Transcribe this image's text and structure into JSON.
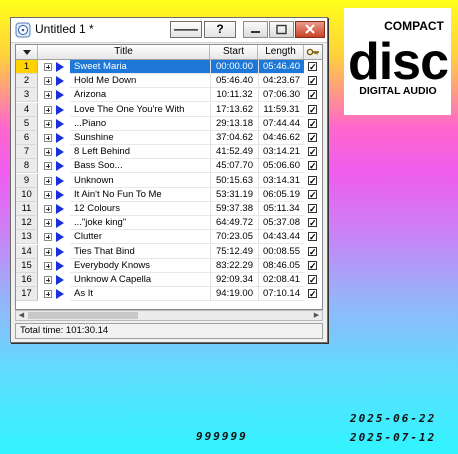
{
  "window": {
    "title": "Untitled 1 *",
    "toolbar_buttons": [
      "——",
      "?"
    ]
  },
  "columns": {
    "title": "Title",
    "start": "Start",
    "length": "Length"
  },
  "tracks": [
    {
      "num": "1",
      "title": "Sweet Maria",
      "start": "00:00.00",
      "length": "05:46.40",
      "selected": true
    },
    {
      "num": "2",
      "title": "Hold Me Down",
      "start": "05:46.40",
      "length": "04:23.67"
    },
    {
      "num": "3",
      "title": "Arizona",
      "start": "10:11.32",
      "length": "07:06.30"
    },
    {
      "num": "4",
      "title": "Love The One You're With",
      "start": "17:13.62",
      "length": "11:59.31"
    },
    {
      "num": "5",
      "title": "...Piano",
      "start": "29:13.18",
      "length": "07:44.44"
    },
    {
      "num": "6",
      "title": "Sunshine",
      "start": "37:04.62",
      "length": "04:46.62"
    },
    {
      "num": "7",
      "title": "8 Left Behind",
      "start": "41:52.49",
      "length": "03:14.21"
    },
    {
      "num": "8",
      "title": "Bass Soo...",
      "start": "45:07.70",
      "length": "05:06.60"
    },
    {
      "num": "9",
      "title": "Unknown",
      "start": "50:15.63",
      "length": "03:14.31"
    },
    {
      "num": "10",
      "title": "It Ain't No Fun To Me",
      "start": "53:31.19",
      "length": "06:05.19"
    },
    {
      "num": "11",
      "title": "12 Colours",
      "start": "59:37.38",
      "length": "05:11.34"
    },
    {
      "num": "12",
      "title": "...\"joke king\"",
      "start": "64:49.72",
      "length": "05:37.08"
    },
    {
      "num": "13",
      "title": "Clutter",
      "start": "70:23.05",
      "length": "04:43.44"
    },
    {
      "num": "14",
      "title": "Ties That Bind",
      "start": "75:12.49",
      "length": "00:08.55"
    },
    {
      "num": "15",
      "title": "Everybody Knows",
      "start": "83:22.29",
      "length": "08:46.05"
    },
    {
      "num": "16",
      "title": "Unknow A Capella",
      "start": "92:09.34",
      "length": "02:08.41"
    },
    {
      "num": "17",
      "title": "As It",
      "start": "94:19.00",
      "length": "07:10.14"
    }
  ],
  "status": {
    "total_time": "Total time: 101:30.14"
  },
  "logo": {
    "line1": "COMPACT",
    "line2": "disc",
    "line3": "DIGITAL AUDIO"
  },
  "footer": {
    "code": "999999",
    "date1": "2025-06-22",
    "date2": "2025-07-12"
  }
}
